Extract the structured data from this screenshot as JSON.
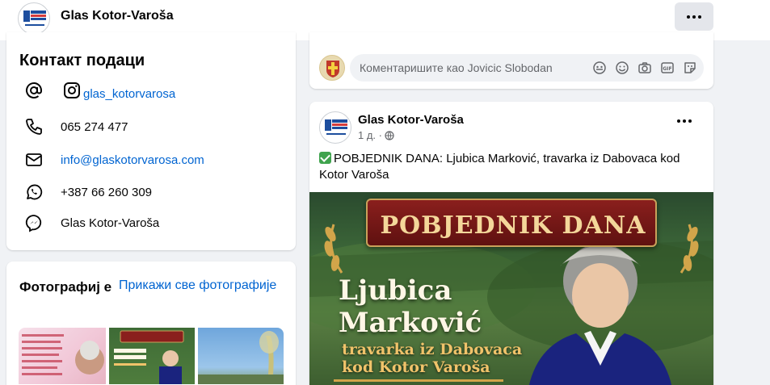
{
  "header": {
    "page_name": "Glas Kotor-Varoša"
  },
  "contact": {
    "title": "Контакт подаци",
    "instagram": "glas_kotorvarosa",
    "phone": "065 274 477",
    "email": "info@glaskotorvarosa.com",
    "whatsapp": "+387 66 260 309",
    "messenger": "Glas Kotor-Varoša"
  },
  "photos": {
    "title": "Фотографиј е",
    "see_all": "Прикажи све фотографије"
  },
  "comment": {
    "placeholder": "Коментаришите као Jovicic Slobodan"
  },
  "post": {
    "author": "Glas Kotor-Varoša",
    "time": "1 д. ·",
    "text": "POBJEDNIK DANA: Ljubica Marković, travarka iz Dabovaca kod Kotor Varoša",
    "banner": {
      "title": "POBJEDNIK DANA",
      "name_line1": "Ljubica",
      "name_line2": "Marković",
      "sub_line1": "travarka iz Dabovaca",
      "sub_line2": "kod Kotor Varoša"
    }
  },
  "icons": {
    "at": "at-icon",
    "instagram": "instagram-icon",
    "phone": "phone-icon",
    "email": "envelope-icon",
    "whatsapp": "whatsapp-icon",
    "messenger": "messenger-icon",
    "globe": "globe-icon"
  },
  "colors": {
    "link": "#0064d1",
    "background": "#f0f2f5",
    "banner_red": "#8a1f1d",
    "banner_gold": "#f4d79a"
  }
}
